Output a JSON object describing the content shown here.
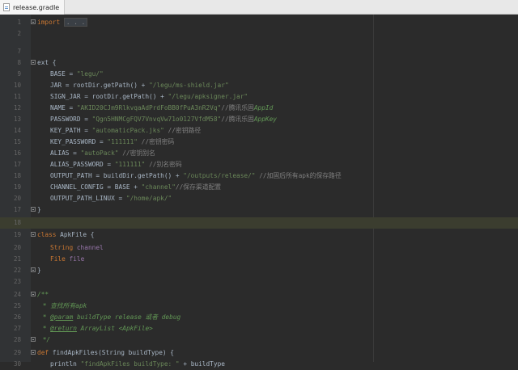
{
  "tab": {
    "label": "release.gradle",
    "icon": "file-icon"
  },
  "lines": [
    {
      "n": "1",
      "parts": [
        [
          "kw",
          "import "
        ],
        [
          "fold",
          ". . ."
        ]
      ]
    },
    {
      "n": "2",
      "parts": []
    },
    {
      "n": "7",
      "parts": []
    },
    {
      "n": "8",
      "parts": [
        [
          "txt",
          "ext {"
        ]
      ]
    },
    {
      "n": "9",
      "parts": [
        [
          "txt",
          "BASE = "
        ],
        [
          "str",
          "\"legu/\""
        ]
      ]
    },
    {
      "n": "10",
      "parts": [
        [
          "txt",
          "JAR = rootDir.getPath() + "
        ],
        [
          "str",
          "\"/legu/ms-shield.jar\""
        ]
      ]
    },
    {
      "n": "11",
      "parts": [
        [
          "txt",
          "SIGN_JAR = rootDir.getPath() + "
        ],
        [
          "str",
          "\"/legu/apksigner.jar\""
        ]
      ]
    },
    {
      "n": "12",
      "parts": [
        [
          "txt",
          "NAME = "
        ],
        [
          "str",
          "\"AKID20CJm9RlkvqaAdPrdFoBB0fPuA3nR2Vq\""
        ],
        [
          "cm",
          "//腾讯乐固"
        ],
        [
          "doc",
          "AppId"
        ]
      ]
    },
    {
      "n": "13",
      "parts": [
        [
          "txt",
          "PASSWORD = "
        ],
        [
          "str",
          "\"Qgn5HNMCgFQV7VnvqVw71o0127VfdM58\""
        ],
        [
          "cm",
          "//腾讯乐固"
        ],
        [
          "doc",
          "AppKey"
        ]
      ]
    },
    {
      "n": "14",
      "parts": [
        [
          "txt",
          "KEY_PATH = "
        ],
        [
          "str",
          "\"automaticPack.jks\""
        ],
        [
          "cm",
          " //密钥路径"
        ]
      ]
    },
    {
      "n": "15",
      "parts": [
        [
          "txt",
          "KEY_PASSWORD = "
        ],
        [
          "str",
          "\"111111\""
        ],
        [
          "cm",
          " //密钥密码"
        ]
      ]
    },
    {
      "n": "16",
      "parts": [
        [
          "txt",
          "ALIAS = "
        ],
        [
          "str",
          "\"autoPack\""
        ],
        [
          "cm",
          " //密钥别名"
        ]
      ]
    },
    {
      "n": "17",
      "parts": [
        [
          "txt",
          "ALIAS_PASSWORD = "
        ],
        [
          "str",
          "\"111111\""
        ],
        [
          "cm",
          " //别名密码"
        ]
      ]
    },
    {
      "n": "18",
      "parts": [
        [
          "txt",
          "OUTPUT_PATH = buildDir.getPath() + "
        ],
        [
          "str",
          "\"/outputs/release/\""
        ],
        [
          "cm",
          " //加固后所有apk的保存路径"
        ]
      ]
    },
    {
      "n": "19",
      "parts": [
        [
          "txt",
          "CHANNEL_CONFIG = BASE + "
        ],
        [
          "str",
          "\"channel\""
        ],
        [
          "cm",
          "//保存渠道配置"
        ]
      ]
    },
    {
      "n": "20",
      "parts": [
        [
          "txt",
          "OUTPUT_PATH_LINUX = "
        ],
        [
          "str",
          "\"/home/apk/\""
        ]
      ]
    },
    {
      "n": "17",
      "parts": [
        [
          "txt",
          "}"
        ]
      ]
    },
    {
      "n": "18",
      "parts": []
    },
    {
      "n": "19",
      "parts": [
        [
          "kw",
          "class "
        ],
        [
          "txt",
          "ApkFile {"
        ]
      ]
    },
    {
      "n": "20",
      "parts": [
        [
          "kw",
          "String "
        ],
        [
          "fld",
          "channel"
        ]
      ]
    },
    {
      "n": "21",
      "parts": [
        [
          "kw",
          "File "
        ],
        [
          "fld",
          "file"
        ]
      ]
    },
    {
      "n": "22",
      "parts": [
        [
          "txt",
          "}"
        ]
      ]
    },
    {
      "n": "23",
      "parts": []
    },
    {
      "n": "24",
      "parts": [
        [
          "doc",
          "/**"
        ]
      ]
    },
    {
      "n": "25",
      "parts": [
        [
          "doc",
          " * 查找所有apk"
        ]
      ]
    },
    {
      "n": "26",
      "parts": [
        [
          "doc",
          " * "
        ],
        [
          "tag",
          "@param"
        ],
        [
          "doc",
          " buildType release 或者 debug"
        ]
      ]
    },
    {
      "n": "27",
      "parts": [
        [
          "doc",
          " * "
        ],
        [
          "tag",
          "@return"
        ],
        [
          "doc",
          " ArrayList <ApkFile>"
        ]
      ]
    },
    {
      "n": "28",
      "parts": [
        [
          "doc",
          " */"
        ]
      ]
    },
    {
      "n": "29",
      "parts": [
        [
          "kw",
          "def "
        ],
        [
          "txt",
          "findApkFiles(String buildType) {"
        ]
      ]
    },
    {
      "n": "30",
      "parts": [
        [
          "txt",
          "println "
        ],
        [
          "str",
          "\"findApkFiles buildType: \""
        ],
        [
          "txt",
          " + buildType"
        ]
      ]
    }
  ]
}
